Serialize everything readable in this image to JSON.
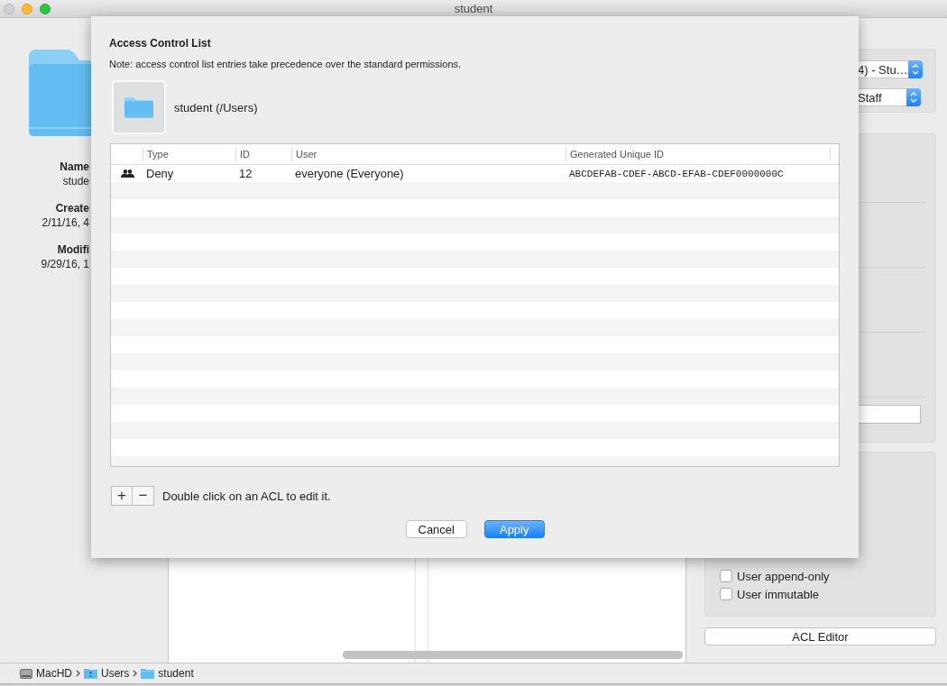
{
  "window": {
    "title": "student"
  },
  "info": [
    {
      "label": "Name",
      "value": "stude"
    },
    {
      "label": "Create",
      "value": "2/11/16, 4"
    },
    {
      "label": "Modifi",
      "value": "9/29/16, 1"
    }
  ],
  "popups": [
    {
      "value": "4) - Stu…"
    },
    {
      "value": "Staff"
    }
  ],
  "flags": [
    {
      "label": "User append-only",
      "checked": false
    },
    {
      "label": "User immutable",
      "checked": false
    }
  ],
  "acl_editor_button": "ACL Editor",
  "breadcrumb": [
    {
      "label": "MacHD",
      "kind": "drive"
    },
    {
      "label": "Users",
      "kind": "users"
    },
    {
      "label": "student",
      "kind": "folder"
    }
  ],
  "sheet": {
    "title": "Access Control List",
    "note": "Note: access control list entries take precedence over the standard permissions.",
    "item": "student (/Users)",
    "table": {
      "columns": [
        "Type",
        "ID",
        "User",
        "Generated Unique ID"
      ],
      "rows": [
        {
          "kind": "group",
          "type": "Deny",
          "id": "12",
          "user": "everyone (Everyone)",
          "guid": "ABCDEFAB-CDEF-ABCD-EFAB-CDEF0000000C"
        }
      ]
    },
    "add_button": "+",
    "remove_button": "−",
    "hint": "Double click on an ACL to edit it.",
    "buttons": [
      {
        "label": "Cancel",
        "default": false
      },
      {
        "label": "Apply",
        "default": true
      }
    ]
  }
}
